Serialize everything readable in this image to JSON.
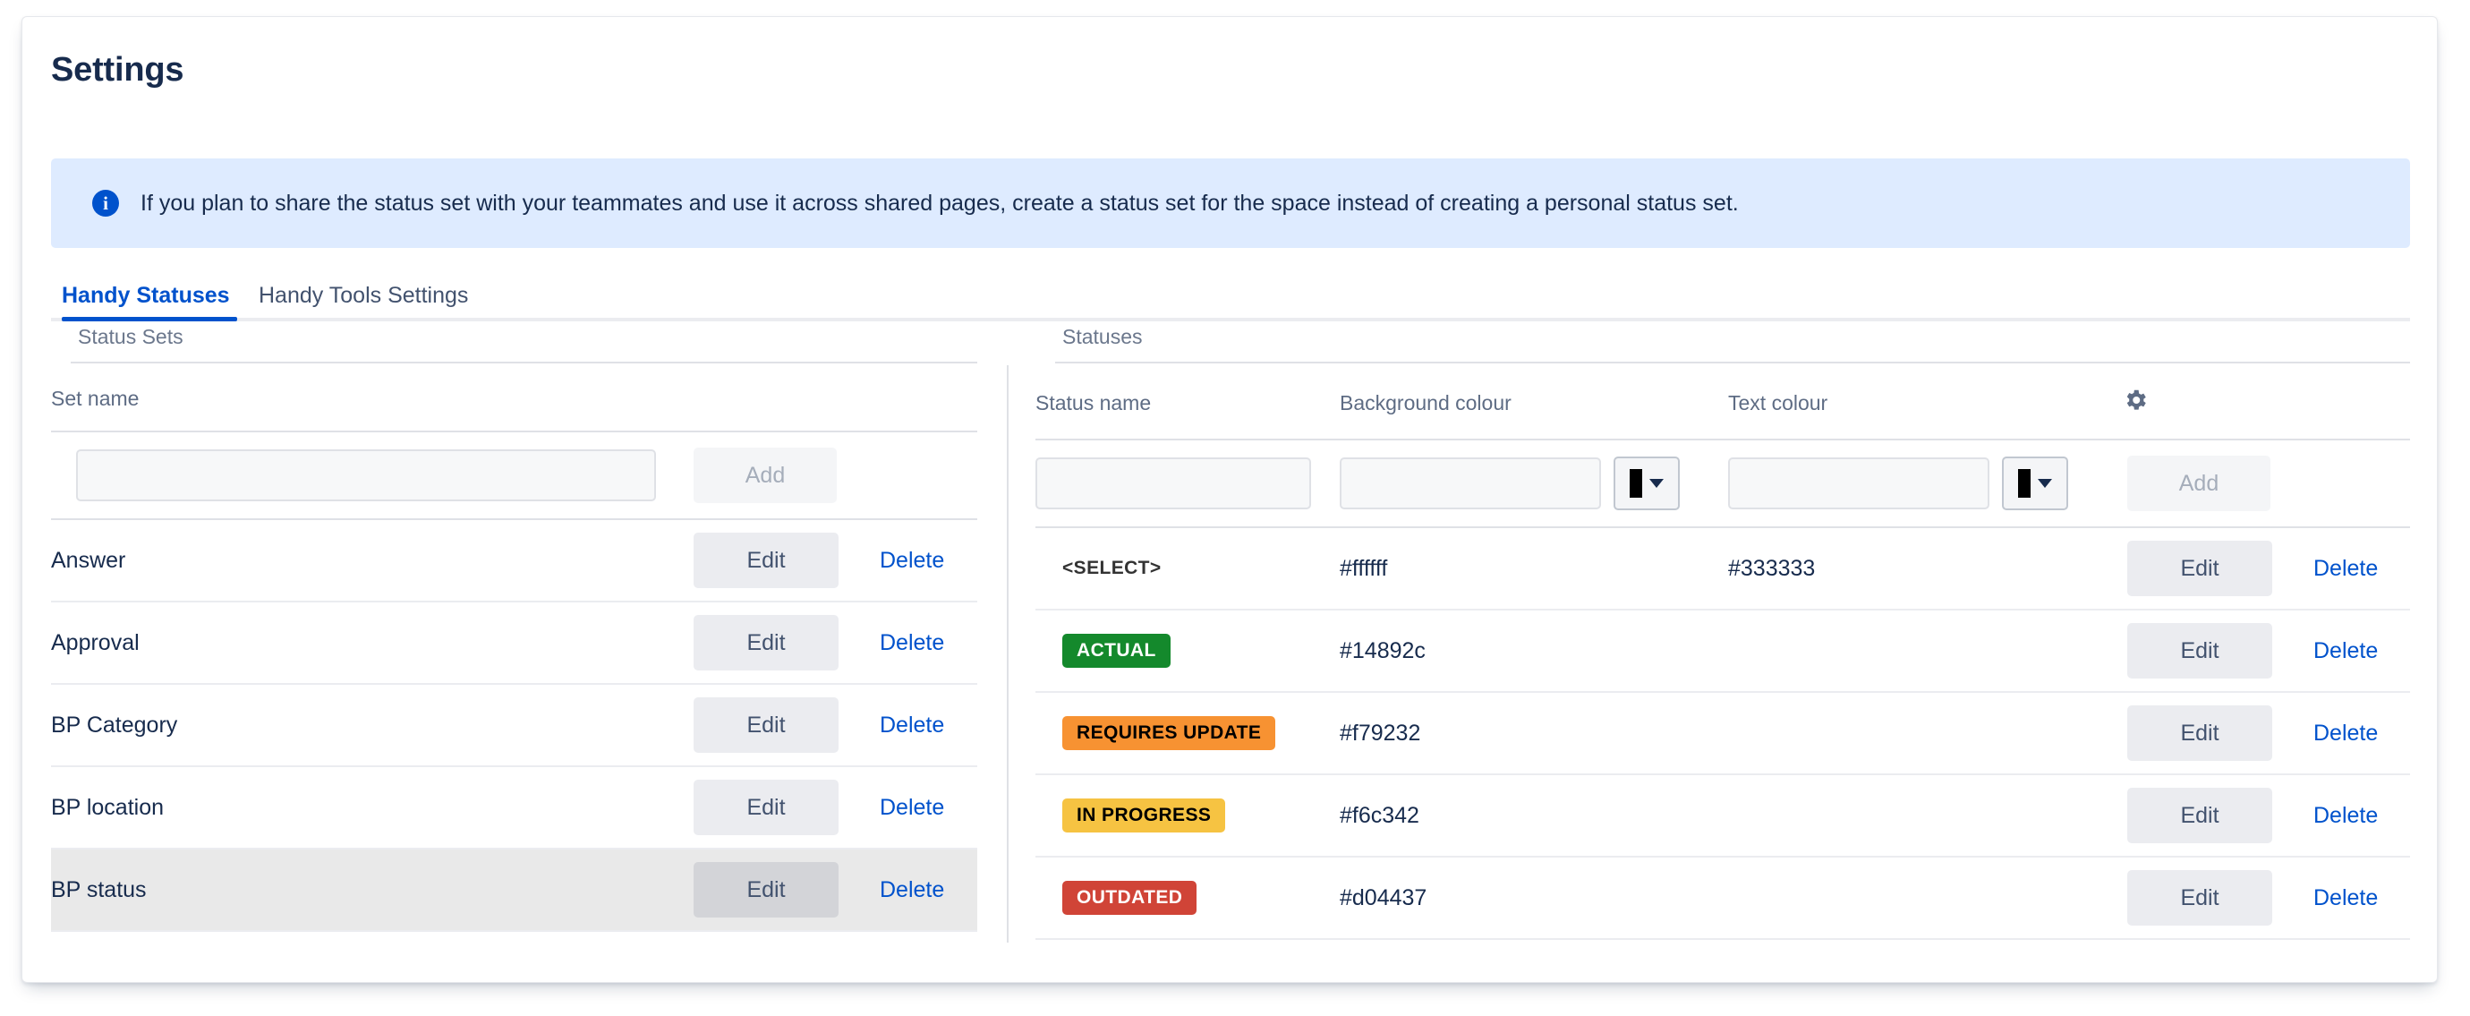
{
  "page": {
    "title": "Settings"
  },
  "banner": {
    "icon": "info-icon",
    "glyph": "i",
    "text": "If you plan to share the status set with your teammates and use it across shared pages, create a status set for the space instead of creating a personal status set.",
    "background": "#deebff",
    "icon_color": "#0052cc"
  },
  "tabs": [
    {
      "label": "Handy Statuses",
      "active": true
    },
    {
      "label": "Handy Tools Settings",
      "active": false
    }
  ],
  "status_sets": {
    "section_label": "Status Sets",
    "column_header": "Set name",
    "new_row": {
      "name_value": "",
      "name_placeholder": "",
      "add_label": "Add"
    },
    "row_actions": {
      "edit_label": "Edit",
      "delete_label": "Delete"
    },
    "rows": [
      {
        "name": "Answer",
        "selected": false
      },
      {
        "name": "Approval",
        "selected": false
      },
      {
        "name": "BP Category",
        "selected": false
      },
      {
        "name": "BP location",
        "selected": false
      },
      {
        "name": "BP status",
        "selected": true
      }
    ]
  },
  "statuses": {
    "section_label": "Statuses",
    "columns": {
      "status_name": "Status name",
      "background_colour": "Background colour",
      "text_colour": "Text colour",
      "settings_icon": "gear-icon"
    },
    "new_row": {
      "status_name_value": "",
      "background_colour_value": "",
      "text_colour_value": "",
      "background_swatch": "#000000",
      "text_swatch": "#000000",
      "add_label": "Add"
    },
    "row_actions": {
      "edit_label": "Edit",
      "delete_label": "Delete"
    },
    "rows": [
      {
        "name": "<SELECT>",
        "background_colour": "#ffffff",
        "text_colour": "#333333",
        "badge_bg": "#ffffff",
        "badge_fg": "#333333",
        "plain": true
      },
      {
        "name": "ACTUAL",
        "background_colour": "#14892c",
        "text_colour": "",
        "badge_bg": "#14892c",
        "badge_fg": "#ffffff",
        "plain": false
      },
      {
        "name": "REQUIRES UPDATE",
        "background_colour": "#f79232",
        "text_colour": "",
        "badge_bg": "#f79232",
        "badge_fg": "#000000",
        "plain": false
      },
      {
        "name": "IN PROGRESS",
        "background_colour": "#f6c342",
        "text_colour": "",
        "badge_bg": "#f6c342",
        "badge_fg": "#000000",
        "plain": false
      },
      {
        "name": "OUTDATED",
        "background_colour": "#d04437",
        "text_colour": "",
        "badge_bg": "#d04437",
        "badge_fg": "#ffffff",
        "plain": false
      }
    ]
  },
  "theme": {
    "link": "#0052cc",
    "text": "#172b4d",
    "muted": "#6b778c",
    "selected_row": "#e9e9e9"
  }
}
